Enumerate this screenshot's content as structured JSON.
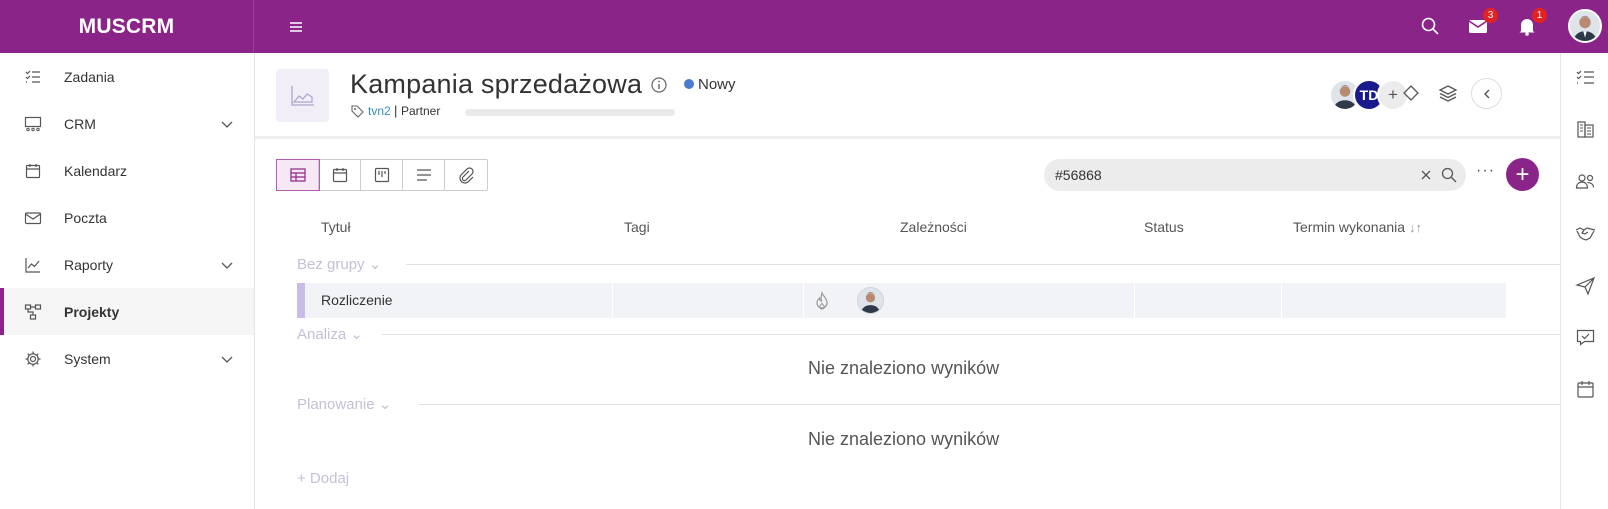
{
  "app": {
    "brand": "MUSCRM",
    "notifications": {
      "mail_count": "3",
      "bell_count": "1"
    }
  },
  "sidebar": {
    "items": [
      {
        "label": "Zadania",
        "icon": "tasks-icon",
        "has_children": false
      },
      {
        "label": "CRM",
        "icon": "crm-icon",
        "has_children": true
      },
      {
        "label": "Kalendarz",
        "icon": "calendar-icon",
        "has_children": false
      },
      {
        "label": "Poczta",
        "icon": "mail-icon",
        "has_children": false
      },
      {
        "label": "Raporty",
        "icon": "chart-icon",
        "has_children": true
      },
      {
        "label": "Projekty",
        "icon": "projects-icon",
        "has_children": false,
        "active": true
      },
      {
        "label": "System",
        "icon": "gear-icon",
        "has_children": true
      }
    ]
  },
  "project": {
    "title": "Kampania sprzedażowa",
    "status": "Nowy",
    "status_color": "#4a7bd1",
    "tag": "tvn2",
    "separator": "|",
    "client": "Partner",
    "progress": 0,
    "members": [
      {
        "type": "photo"
      },
      {
        "initials": "TD"
      },
      {
        "label": "+"
      }
    ]
  },
  "toolbar": {
    "views": [
      "table-view-icon",
      "calendar-view-icon",
      "kanban-view-icon",
      "list-view-icon",
      "attachments-icon"
    ],
    "search_value": "#56868",
    "more_label": "···",
    "add_label": "+"
  },
  "table": {
    "columns": {
      "title": "Tytuł",
      "tags": "Tagi",
      "dependencies": "Zależności",
      "status": "Status",
      "due": "Termin wykonania",
      "due_sort": "↓↑"
    },
    "groups": [
      {
        "label": "Bez grupy",
        "chevron": "⌄"
      },
      {
        "label": "Analiza",
        "chevron": "⌄"
      },
      {
        "label": "Planowanie",
        "chevron": "⌄"
      }
    ],
    "rows": [
      {
        "title": "Rozliczenie"
      }
    ],
    "no_results": "Nie znaleziono wyników",
    "add_label": "+ Dodaj"
  },
  "colors": {
    "brand": "#8a2489",
    "group_accent": "#c9bde7",
    "group_text": "#c4c0d6"
  }
}
